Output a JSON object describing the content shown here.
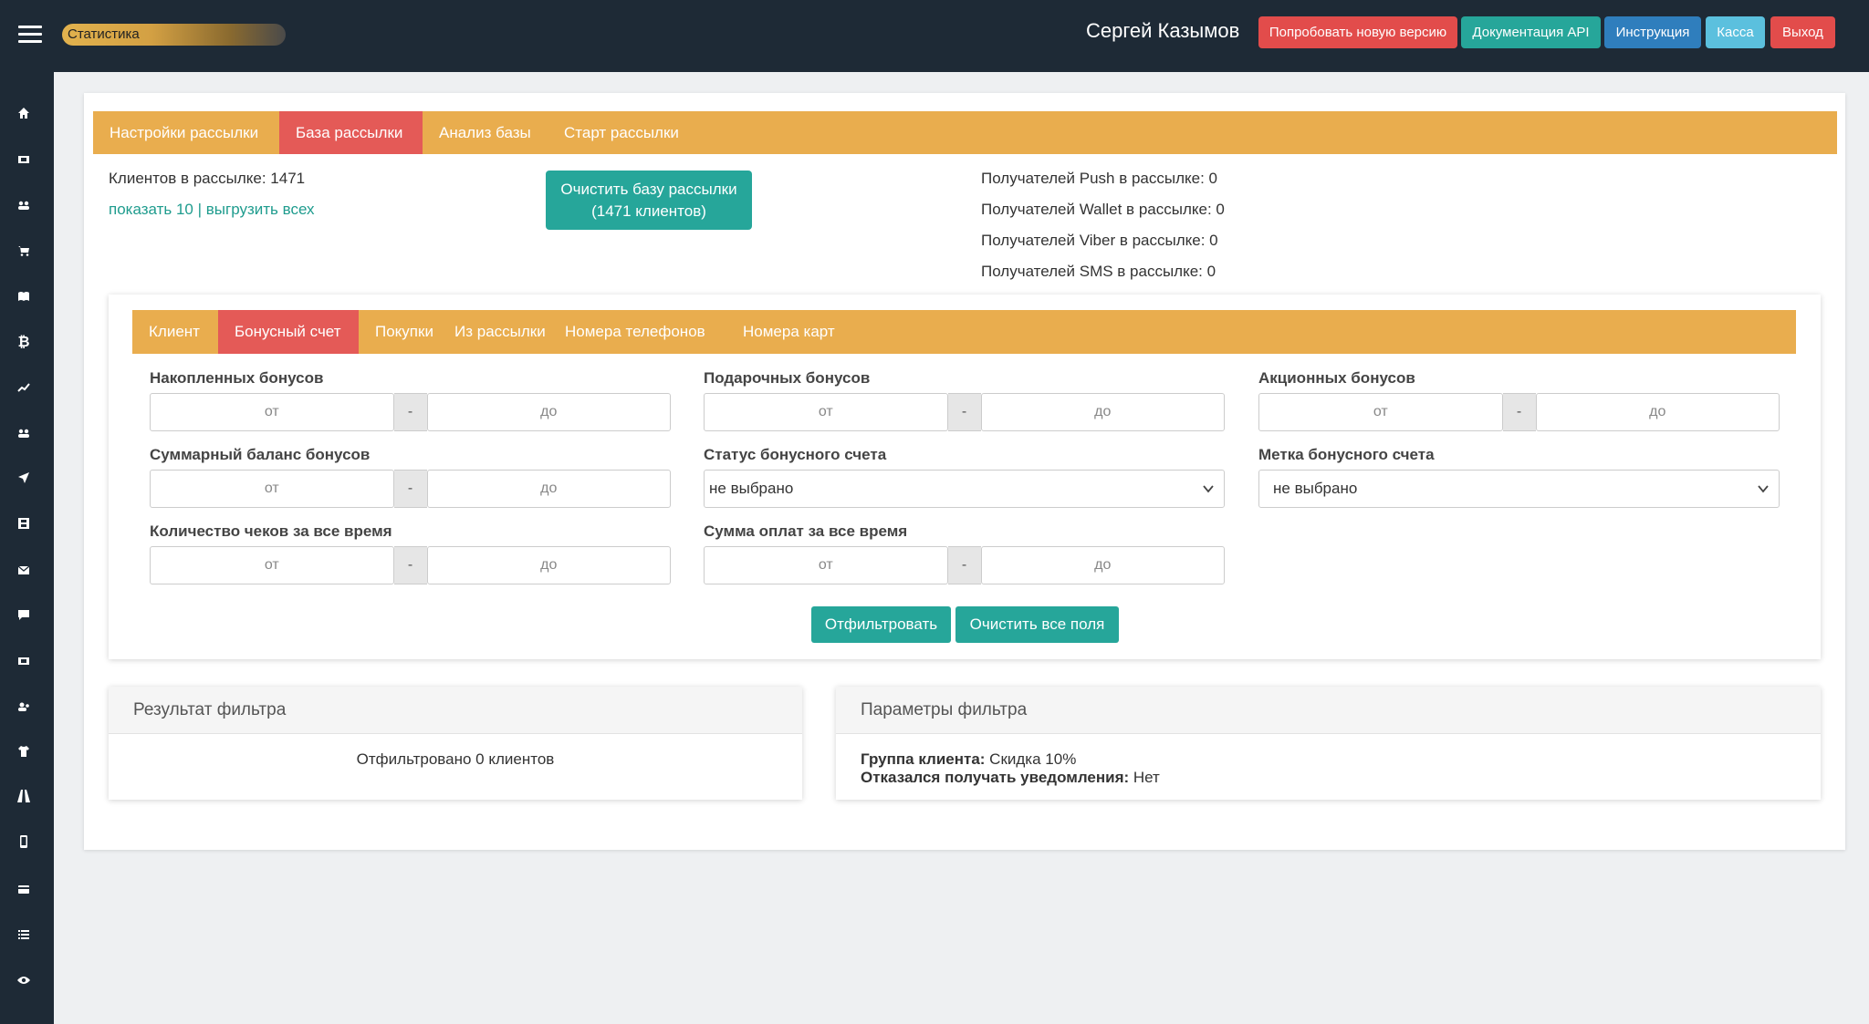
{
  "topbar": {
    "stat_label": "Статистика",
    "user_name": "Сергей Казымов",
    "buttons": {
      "try_new": "Попробовать новую версию",
      "api_docs": "Документация API",
      "instruction": "Инструкция",
      "kassa": "Касса",
      "logout": "Выход"
    }
  },
  "sidebar": {
    "icons": [
      "home-icon",
      "ticket-icon",
      "users-icon",
      "cart-icon",
      "book-icon",
      "bitcoin-icon",
      "chart-line-icon",
      "group-icon",
      "send-icon",
      "film-icon",
      "envelope-icon",
      "comment-icon",
      "ticket2-icon",
      "user-group-icon",
      "shirt-icon",
      "road-icon",
      "mobile-icon",
      "credit-card-icon",
      "list-icon",
      "eye-icon"
    ]
  },
  "main_tabs": [
    {
      "label": "Настройки рассылки",
      "active": false
    },
    {
      "label": "База рассылки",
      "active": true
    },
    {
      "label": "Анализ базы",
      "active": false
    },
    {
      "label": "Старт рассылки",
      "active": false
    }
  ],
  "summary": {
    "clients_in_mailing": "Клиентов в рассылке: 1471",
    "show_10": "показать 10",
    "separator": " | ",
    "export_all": "выгрузить всех",
    "clear_base_line1": "Очистить базу рассылки",
    "clear_base_line2": "(1471 клиентов)",
    "push": "Получателей Push в рассылке: 0",
    "wallet": "Получателей Wallet в рассылке: 0",
    "viber": "Получателей Viber в рассылке: 0",
    "sms": "Получателей SMS в рассылке: 0"
  },
  "filter_tabs": [
    {
      "label": "Клиент",
      "active": false
    },
    {
      "label": "Бонусный счет",
      "active": true
    },
    {
      "label": "Покупки",
      "active": false
    },
    {
      "label": "Из рассылки",
      "active": false
    },
    {
      "label": "Номера телефонов",
      "active": false
    },
    {
      "label": "Номера карт",
      "active": false
    }
  ],
  "filters": {
    "accumulated": "Накопленных бонусов",
    "gift": "Подарочных бонусов",
    "promo": "Акционных бонусов",
    "total_balance": "Суммарный баланс бонусов",
    "account_status": "Статус бонусного счета",
    "account_tag": "Метка бонусного счета",
    "receipts_count": "Количество чеков за все время",
    "payments_sum": "Сумма оплат за все время",
    "from_placeholder": "от",
    "to_placeholder": "до",
    "dash": "-",
    "not_selected": "не выбрано",
    "filter_button": "Отфильтровать",
    "clear_fields_button": "Очистить все поля"
  },
  "result": {
    "title": "Результат фильтра",
    "text": "Отфильтровано 0 клиентов"
  },
  "params": {
    "title": "Параметры фильтра",
    "group_label": "Группа клиента:",
    "group_value": " Скидка 10%",
    "refused_label": "Отказался получать уведомления:",
    "refused_value": " Нет"
  }
}
